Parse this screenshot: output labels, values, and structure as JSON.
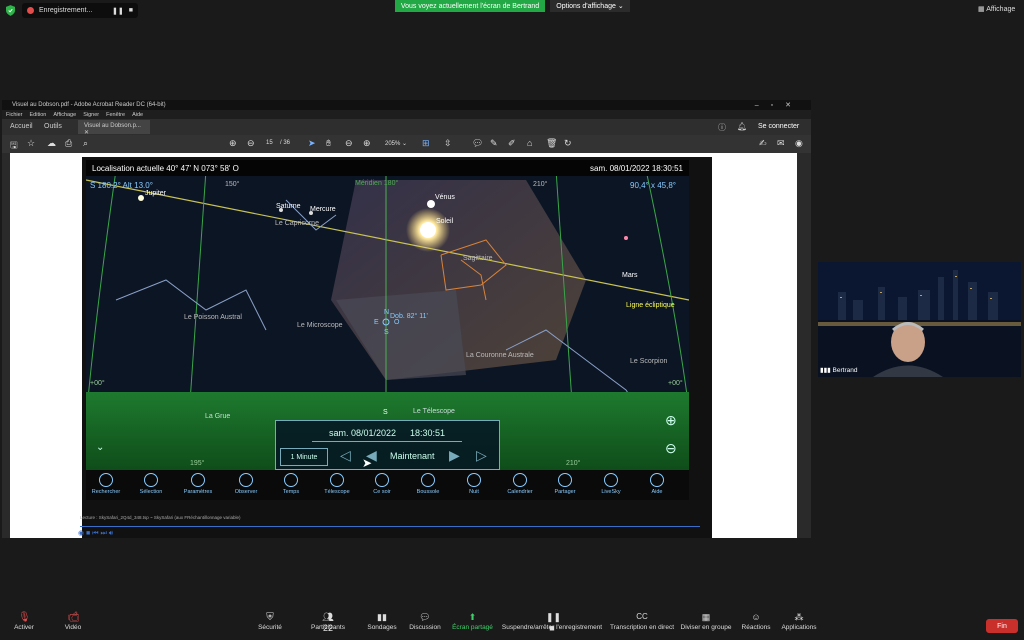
{
  "top": {
    "recording_label": "Enregistrement...",
    "share_banner": "Vous voyez actuellement l'écran de Bertrand",
    "view_options": "Options d'affichage",
    "affichage": "Affichage"
  },
  "acrobat": {
    "title": "Visuel au Dobson.pdf - Adobe Acrobat Reader DC (64-bit)",
    "menu": [
      "Fichier",
      "Edition",
      "Affichage",
      "Signer",
      "Fenêtre",
      "Aide"
    ],
    "tabs": [
      "Accueil",
      "Outils",
      "Visuel au Dobson.p..."
    ],
    "login": "Se connecter",
    "page_current": "15",
    "page_total": "/ 36",
    "zoom": "205%"
  },
  "sky": {
    "location": "Localisation actuelle  40° 47' N 073° 58' O",
    "datetime": "sam. 08/01/2022  18:30:51",
    "azimuth": "S  180.2° Alt 13.0°",
    "fov": "90,4° x 45,8°",
    "labels": {
      "jupiter": "Jupiter",
      "venus": "Vénus",
      "saturne": "Saturne",
      "mercure": "Mercure",
      "soleil": "Soleil",
      "capricorne": "Le Capricorne",
      "sagittaire": "Sagittaire",
      "mars": "Mars",
      "ecliptique": "Ligne écliptique",
      "poisson": "Le Poisson Austral",
      "microscope": "Le Microscope",
      "couronne": "La Couronne Australe",
      "scorpion": "Le Scorpion",
      "grue": "La Grue",
      "telescope": "Le Télescope",
      "meridien": "Méridien 180°",
      "dob": "Dob. 82° 11'",
      "n": "N",
      "e": "E",
      "o": "O",
      "s": "S",
      "deg150": "150°",
      "deg210": "210°",
      "deg0a": "+00°",
      "deg0b": "+00°",
      "deg195": "195°",
      "deg210b": "210°"
    },
    "panel": {
      "date": "sam.  08/01/2022",
      "time": "18:30:51",
      "step": "1 Minute",
      "now": "Maintenant"
    },
    "toolbar": [
      "Rechercher",
      "Sélection",
      "Paramètres",
      "Observer",
      "Temps",
      "Télescope",
      "Ce soir",
      "Boussole",
      "Nuit",
      "Calendrier",
      "Partager",
      "LiveSky",
      "Aide"
    ]
  },
  "caption": "Lecture : SkySafari_2Q4d_348.tsp ~ SkySafari (aux FRéchantillonnage variable)",
  "cam": {
    "name": "Bertrand"
  },
  "bottom": {
    "items": [
      "Activer",
      "Vidéo",
      "Sécurité",
      "Participants",
      "Sondages",
      "Discussion",
      "Écran partagé",
      "Suspendre/arrêter l'enregistrement",
      "Transcription en direct",
      "Diviser en groupe",
      "Réactions",
      "Applications"
    ],
    "participants_count": "22",
    "end": "Fin"
  }
}
